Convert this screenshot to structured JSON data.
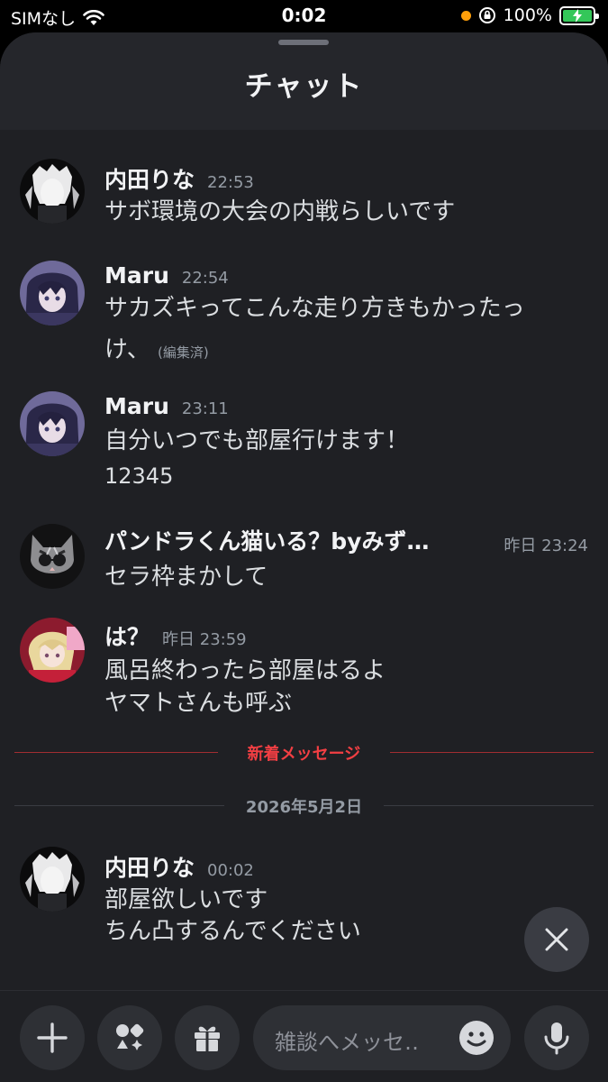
{
  "status_bar": {
    "carrier": "SIMなし",
    "time": "0:02",
    "battery": "100%",
    "battery_level": 1.0
  },
  "sheet": {
    "title": "チャット"
  },
  "messages": [
    {
      "author": "内田りな",
      "time": "22:53",
      "lines": [
        "サボ環境の大会の内戦らしいです"
      ]
    },
    {
      "author": "Maru",
      "time": "22:54",
      "lines": [
        "サカズキってこんな走り方きもかったっ",
        "け、"
      ],
      "edited": "(編集済)"
    },
    {
      "author": "Maru",
      "time": "23:11",
      "lines": [
        "自分いつでも部屋行けます！",
        "12345"
      ]
    },
    {
      "author": "パンドラくん猫いる？byみず…",
      "time": "昨日 23:24",
      "lines": [
        "セラ枠まかして"
      ]
    },
    {
      "author": "は？",
      "time": "昨日 23:59",
      "lines": [
        "風呂終わったら部屋はるよ",
        "ヤマトさんも呼ぶ"
      ]
    },
    {
      "author": "内田りな",
      "time": "00:02",
      "lines": [
        "部屋欲しいです",
        "ちん凸するんでください"
      ]
    }
  ],
  "dividers": {
    "new_messages": "新着メッセージ",
    "date": "2026年5月2日"
  },
  "composer": {
    "placeholder": "雑談へメッセ‥"
  },
  "colors": {
    "background": "#1f2024",
    "header": "#25262b",
    "new_divider": "#f23f43",
    "date_divider": "#949ba4",
    "battery": "#34c759"
  },
  "icons": {
    "wifi": "wifi-icon",
    "lock_rotation": "lock-rotation-icon",
    "close": "close-icon",
    "plus": "plus-icon",
    "apps": "apps-icon",
    "gift": "gift-icon",
    "emoji": "emoji-icon",
    "mic": "mic-icon"
  }
}
